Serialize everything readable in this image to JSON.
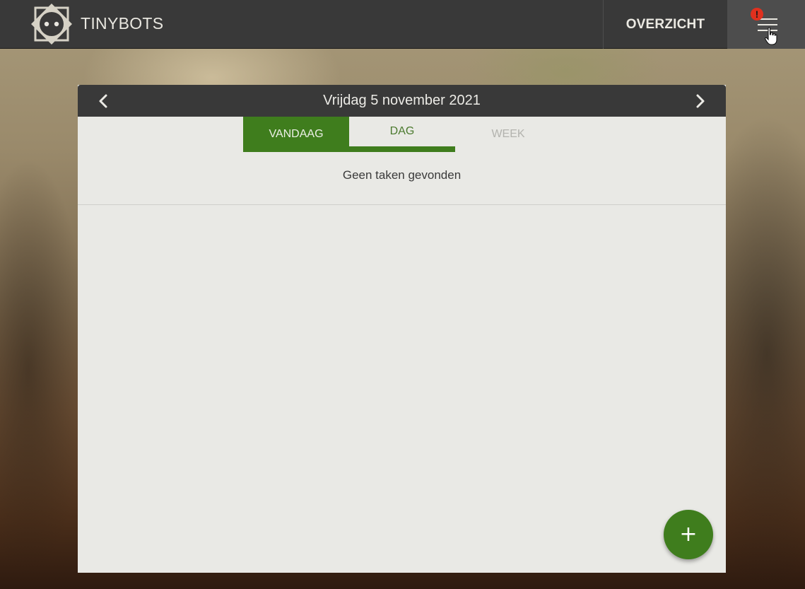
{
  "header": {
    "brand": "TINYBOTS",
    "nav_overview": "OVERZICHT",
    "alert_mark": "!",
    "icons": {
      "logo": "tinybots-logo-icon",
      "menu": "hamburger-menu-icon",
      "cursor": "hand-pointer-icon"
    }
  },
  "calendar": {
    "date_title": "Vrijdag 5 november 2021",
    "prev_icon": "chevron-left-icon",
    "next_icon": "chevron-right-icon",
    "tabs": [
      {
        "label": "VANDAAG",
        "state": "active"
      },
      {
        "label": "DAG",
        "state": "underlined"
      },
      {
        "label": "WEEK",
        "state": "inactive"
      }
    ],
    "empty_message": "Geen taken gevonden",
    "add_label": "+"
  },
  "colors": {
    "topbar": "#393939",
    "accent_green": "#3f7d1d",
    "card_background": "#e9e9e5",
    "alert_red": "#e0301e"
  }
}
